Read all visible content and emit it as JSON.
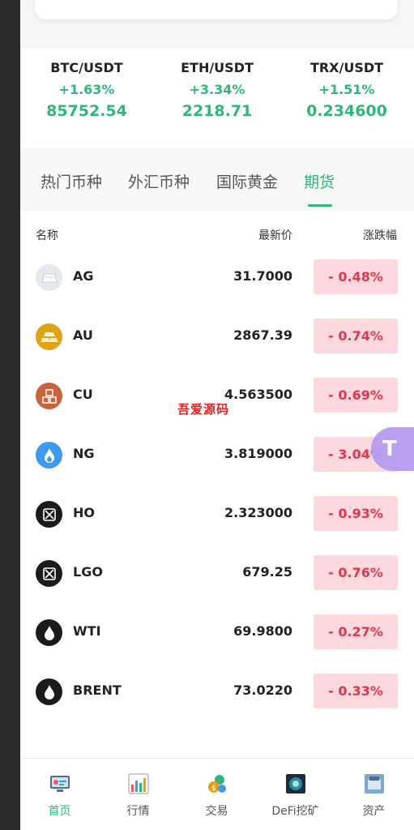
{
  "tickers": [
    {
      "pair": "BTC/USDT",
      "change": "+1.63%",
      "price": "85752.54"
    },
    {
      "pair": "ETH/USDT",
      "change": "+3.34%",
      "price": "2218.71"
    },
    {
      "pair": "TRX/USDT",
      "change": "+1.51%",
      "price": "0.234600"
    }
  ],
  "tabs": [
    "热门币种",
    "外汇币种",
    "国际黄金",
    "期货"
  ],
  "active_tab": "期货",
  "list_header": {
    "name": "名称",
    "last": "最新价",
    "change": "涨跌幅"
  },
  "rows": [
    {
      "symbol": "AG",
      "last": "31.7000",
      "change": "- 0.48%",
      "icon": "silver-bar-icon"
    },
    {
      "symbol": "AU",
      "last": "2867.39",
      "change": "- 0.74%",
      "icon": "gold-bar-icon"
    },
    {
      "symbol": "CU",
      "last": "4.563500",
      "change": "- 0.69%",
      "icon": "copper-icon"
    },
    {
      "symbol": "NG",
      "last": "3.819000",
      "change": "- 3.04%",
      "icon": "flame-icon"
    },
    {
      "symbol": "HO",
      "last": "2.323000",
      "change": "- 0.93%",
      "icon": "fuel-can-icon"
    },
    {
      "symbol": "LGO",
      "last": "679.25",
      "change": "- 0.76%",
      "icon": "fuel-can-icon"
    },
    {
      "symbol": "WTI",
      "last": "69.9800",
      "change": "- 0.27%",
      "icon": "oil-drop-icon"
    },
    {
      "symbol": "BRENT",
      "last": "73.0220",
      "change": "- 0.33%",
      "icon": "oil-drop-icon"
    }
  ],
  "watermark": "吾爱源码",
  "tabbar": [
    {
      "label": "首页",
      "icon": "home-icon",
      "active": true
    },
    {
      "label": "行情",
      "icon": "market-chart-icon",
      "active": false
    },
    {
      "label": "交易",
      "icon": "trade-coins-icon",
      "active": false
    },
    {
      "label": "DeFi挖矿",
      "icon": "defi-mining-icon",
      "active": false
    },
    {
      "label": "资产",
      "icon": "assets-icon",
      "active": false
    }
  ],
  "colors": {
    "up": "#2fb679",
    "down": "#e0364e",
    "down_bg": "#fbd9de",
    "accent": "#2fb679"
  }
}
